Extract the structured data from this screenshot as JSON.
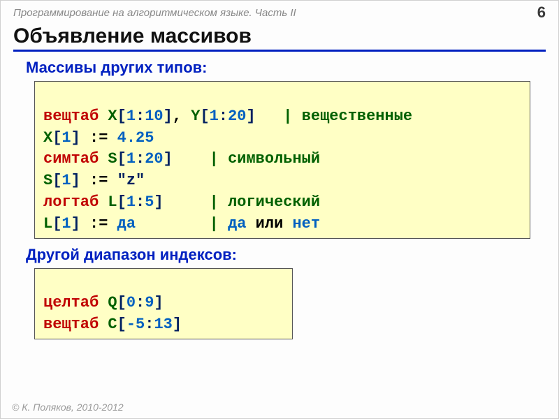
{
  "header": {
    "title": "Программирование на алгоритмическом языке. Часть II",
    "page": "6"
  },
  "heading": "Объявление массивов",
  "section1": {
    "title": "Массивы других типов:",
    "lines": {
      "l1": {
        "kw": "вещтаб",
        "id1": "X",
        "lb1": "[",
        "n1": "1",
        "c1": ":",
        "n2": "10",
        "rb1": "]",
        "cm": ",",
        "id2": "Y",
        "lb2": "[",
        "n3": "1",
        "c2": ":",
        "n4": "20",
        "rb2": "]",
        "bar": "|",
        "cmt": "вещественные"
      },
      "l2": {
        "id": "X",
        "lb": "[",
        "n1": "1",
        "rb": "]",
        "asg": ":=",
        "val": "4.25"
      },
      "l3": {
        "kw": "симтаб",
        "id": "S",
        "lb": "[",
        "n1": "1",
        "c": ":",
        "n2": "20",
        "rb": "]",
        "bar": "|",
        "cmt": "символьный"
      },
      "l4": {
        "id": "S",
        "lb": "[",
        "n1": "1",
        "rb": "]",
        "asg": ":=",
        "val": "\"z\""
      },
      "l5": {
        "kw": "логтаб",
        "id": "L",
        "lb": "[",
        "n1": "1",
        "c": ":",
        "n2": "5",
        "rb": "]",
        "bar": "|",
        "cmt": "логический"
      },
      "l6": {
        "id": "L",
        "lb": "[",
        "n1": "1",
        "rb": "]",
        "asg": ":=",
        "val": "да",
        "bar": "|",
        "c1": "да",
        "or": "или",
        "c2": "нет"
      }
    }
  },
  "section2": {
    "title": "Другой диапазон индексов:",
    "lines": {
      "l1": {
        "kw": "целтаб",
        "id": "Q",
        "lb": "[",
        "n1": "0",
        "c": ":",
        "n2": "9",
        "rb": "]"
      },
      "l2": {
        "kw": "вещтаб",
        "id": "C",
        "lb": "[",
        "n1": "-5",
        "c": ":",
        "n2": "13",
        "rb": "]"
      }
    }
  },
  "footer": "© К. Поляков, 2010-2012"
}
